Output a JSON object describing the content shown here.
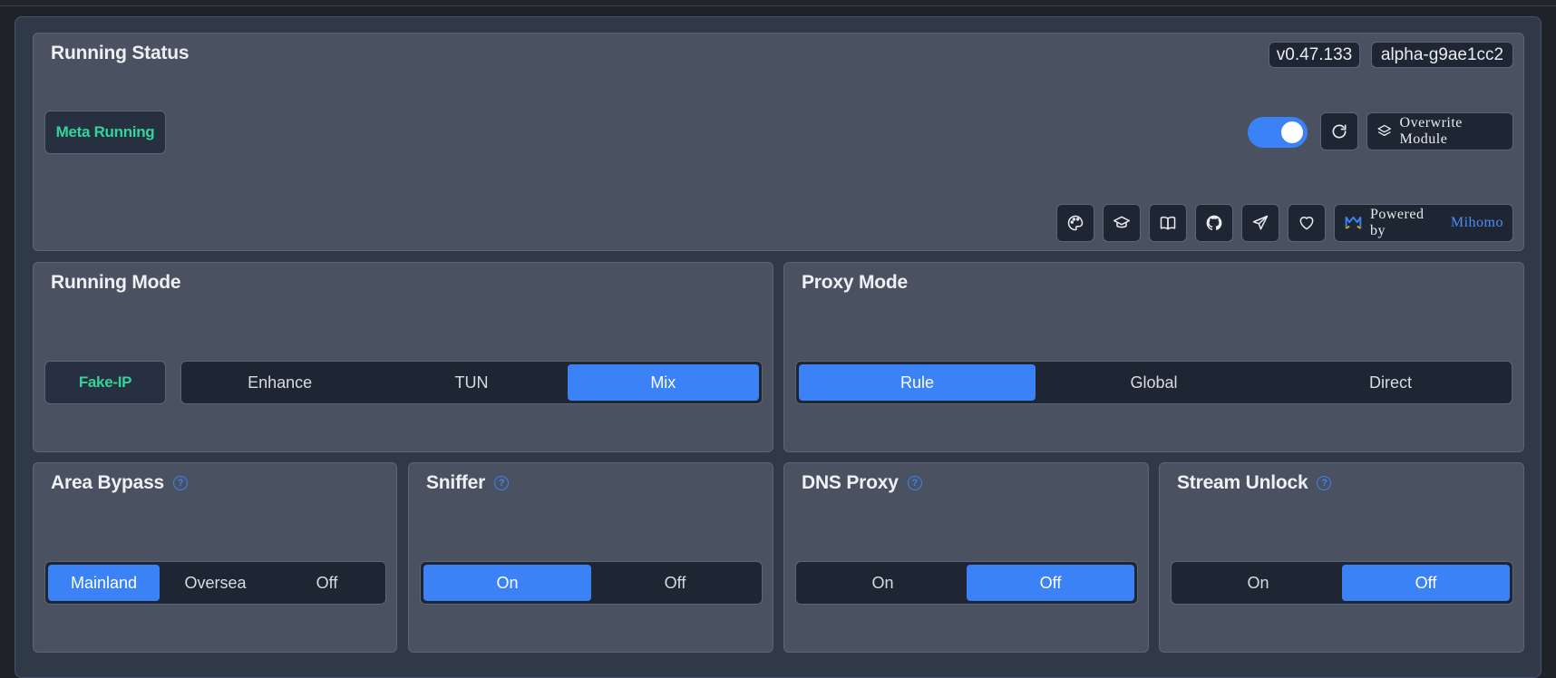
{
  "running_status": {
    "title": "Running Status",
    "version": "v0.47.133",
    "core_version": "alpha-g9ae1cc2",
    "status": "Meta Running",
    "toggle_on": true,
    "overwrite_label": "Overwrite Module",
    "powered_by": "Powered by",
    "powered_name": "Mihomo",
    "icon_buttons": [
      "palette-icon",
      "graduation-cap-icon",
      "book-icon",
      "github-icon",
      "telegram-icon",
      "heart-icon"
    ]
  },
  "running_mode": {
    "title": "Running Mode",
    "dns_mode": "Fake-IP",
    "options": [
      "Enhance",
      "TUN",
      "Mix"
    ],
    "selected": "Mix"
  },
  "proxy_mode": {
    "title": "Proxy Mode",
    "options": [
      "Rule",
      "Global",
      "Direct"
    ],
    "selected": "Rule"
  },
  "area_bypass": {
    "title": "Area Bypass",
    "options": [
      "Mainland",
      "Oversea",
      "Off"
    ],
    "selected": "Mainland"
  },
  "sniffer": {
    "title": "Sniffer",
    "options": [
      "On",
      "Off"
    ],
    "selected": "On"
  },
  "dns_proxy": {
    "title": "DNS Proxy",
    "options": [
      "On",
      "Off"
    ],
    "selected": "Off"
  },
  "stream_unlock": {
    "title": "Stream Unlock",
    "options": [
      "On",
      "Off"
    ],
    "selected": "Off"
  },
  "colors": {
    "accent": "#3b82f6",
    "status_green": "#34d399",
    "card_bg": "#4a5261",
    "segment_bg": "#1f2633"
  }
}
